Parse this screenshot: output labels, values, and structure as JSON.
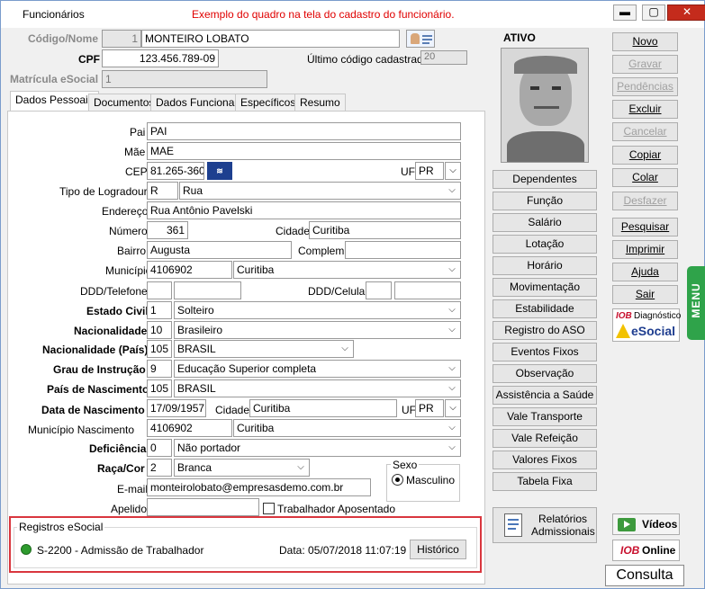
{
  "window": {
    "title": "Funcionários",
    "hint": "Exemplo do quadro na tela do cadastro do funcionário.",
    "minimize": "▬",
    "maximize": "▢",
    "close": "✕"
  },
  "header": {
    "codigo_label": "Código/Nome",
    "codigo_value": "1",
    "nome_value": "MONTEIRO LOBATO",
    "cpf_label": "CPF",
    "cpf_value": "123.456.789-09",
    "ultimo_label": "Último código cadastrado:",
    "ultimo_value": "20",
    "matricula_label": "Matrícula eSocial",
    "matricula_value": "1",
    "status": "ATIVO"
  },
  "tabs": [
    "Dados Pessoais",
    "Documentos",
    "Dados Funcionais",
    "Específicos",
    "Resumo"
  ],
  "form": {
    "pai_label": "Pai",
    "pai": "PAI",
    "mae_label": "Mãe",
    "mae": "MAE",
    "cep_label": "CEP",
    "cep": "81.265-360",
    "uf_label": "UF",
    "uf": "PR",
    "tipo_log_label": "Tipo de Logradouro",
    "tipo_log_code": "R",
    "tipo_log": "Rua",
    "endereco_label": "Endereço",
    "endereco": "Rua Antônio Pavelski",
    "numero_label": "Número",
    "numero": "361",
    "cidade_label": "Cidade",
    "cidade": "Curitiba",
    "bairro_label": "Bairro",
    "bairro": "Augusta",
    "complem_label": "Complem.",
    "complem": "",
    "municipio_label": "Município",
    "municipio_code": "4106902",
    "municipio": "Curitiba",
    "ddd_tel_label": "DDD/Telefone",
    "ddd_cel_label": "DDD/Celular",
    "estado_civil_label": "Estado Civil",
    "estado_civil_code": "1",
    "estado_civil": "Solteiro",
    "nacionalidade_label": "Nacionalidade",
    "nacionalidade_code": "10",
    "nacionalidade": "Brasileiro",
    "nac_pais_label": "Nacionalidade (País)",
    "nac_pais_code": "105",
    "nac_pais": "BRASIL",
    "grau_label": "Grau de Instrução",
    "grau_code": "9",
    "grau": "Educação Superior completa",
    "pais_nasc_label": "País de Nascimento",
    "pais_nasc_code": "105",
    "pais_nasc": "BRASIL",
    "data_nasc_label": "Data de Nascimento",
    "data_nasc": "17/09/1957",
    "cidade_nasc_label": "Cidade",
    "cidade_nasc": "Curitiba",
    "uf_nasc_label": "UF",
    "uf_nasc": "PR",
    "mun_nasc_label": "Município Nascimento",
    "mun_nasc_code": "4106902",
    "mun_nasc": "Curitiba",
    "deficiencia_label": "Deficiência",
    "deficiencia_code": "0",
    "deficiencia": "Não portador",
    "raca_label": "Raça/Cor",
    "raca_code": "2",
    "raca": "Branca",
    "sexo_label": "Sexo",
    "sexo": "Masculino",
    "email_label": "E-mail",
    "email": "monteirolobato@empresasdemo.com.br",
    "apelido_label": "Apelido",
    "apelido": "",
    "aposentado_label": "Trabalhador Aposentado"
  },
  "registros": {
    "title": "Registros eSocial",
    "event": "S-2200 - Admissão de Trabalhador",
    "data": "Data: 05/07/2018 11:07:19",
    "historico": "Histórico",
    "status_color": "#2e9b2e"
  },
  "middle_buttons": [
    "Dependentes",
    "Função",
    "Salário",
    "Lotação",
    "Horário",
    "Movimentação",
    "Estabilidade",
    "Registro do ASO",
    "Eventos Fixos",
    "Observação",
    "Assistência a Saúde",
    "Vale Transporte",
    "Vale Refeição",
    "Valores Fixos",
    "Tabela Fixa"
  ],
  "relatorios": "Relatórios Admissionais",
  "right_buttons": [
    {
      "label": "Novo",
      "enabled": true
    },
    {
      "label": "Gravar",
      "enabled": false
    },
    {
      "label": "Pendências",
      "enabled": false
    },
    {
      "label": "Excluir",
      "enabled": true
    },
    {
      "label": "Cancelar",
      "enabled": false
    },
    {
      "label": "Copiar",
      "enabled": true
    },
    {
      "label": "Colar",
      "enabled": true
    },
    {
      "label": "Desfazer",
      "enabled": false
    },
    {
      "label": "Pesquisar",
      "enabled": true
    },
    {
      "label": "Imprimir",
      "enabled": true
    },
    {
      "label": "Ajuda",
      "enabled": true
    },
    {
      "label": "Sair",
      "enabled": true
    }
  ],
  "iob_diag": {
    "brand": "IOB",
    "label": "Diagnóstico",
    "esocial": "eSocial"
  },
  "menu_tab": "MENU",
  "videos": "Vídeos",
  "iob_online": {
    "brand": "IOB",
    "label": "Online"
  },
  "mode": "Consulta"
}
